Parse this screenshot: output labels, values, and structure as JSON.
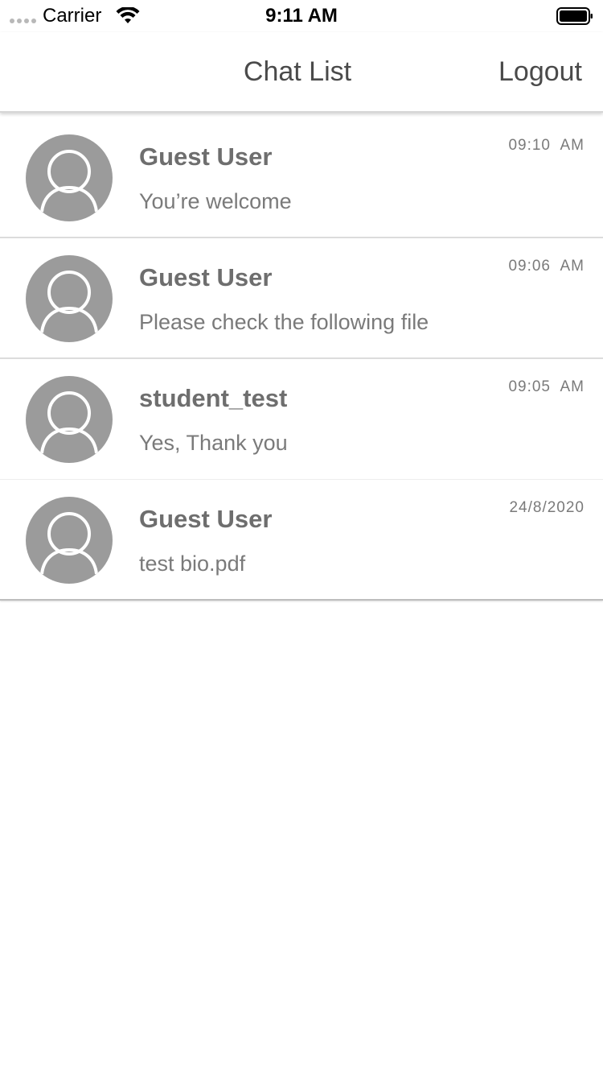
{
  "status_bar": {
    "carrier": "Carrier",
    "time": "9:11 AM"
  },
  "nav": {
    "title": "Chat List",
    "logout_label": "Logout"
  },
  "chats": [
    {
      "name": "Guest User",
      "message": "You’re welcome",
      "time": "09:10  AM"
    },
    {
      "name": "Guest User",
      "message": "Please check the following file",
      "time": "09:06  AM"
    },
    {
      "name": "student_test",
      "message": "Yes, Thank you",
      "time": "09:05  AM"
    },
    {
      "name": "Guest User",
      "message": "test bio.pdf",
      "time": "24/8/2020"
    }
  ],
  "icons": {
    "avatar": "user-avatar-icon",
    "wifi": "wifi-icon",
    "battery": "battery-icon",
    "signal": "signal-dots-icon"
  },
  "colors": {
    "avatar_bg": "#9b9b9b",
    "text_primary": "#4a4a4a",
    "text_secondary": "#7a7a7a"
  }
}
